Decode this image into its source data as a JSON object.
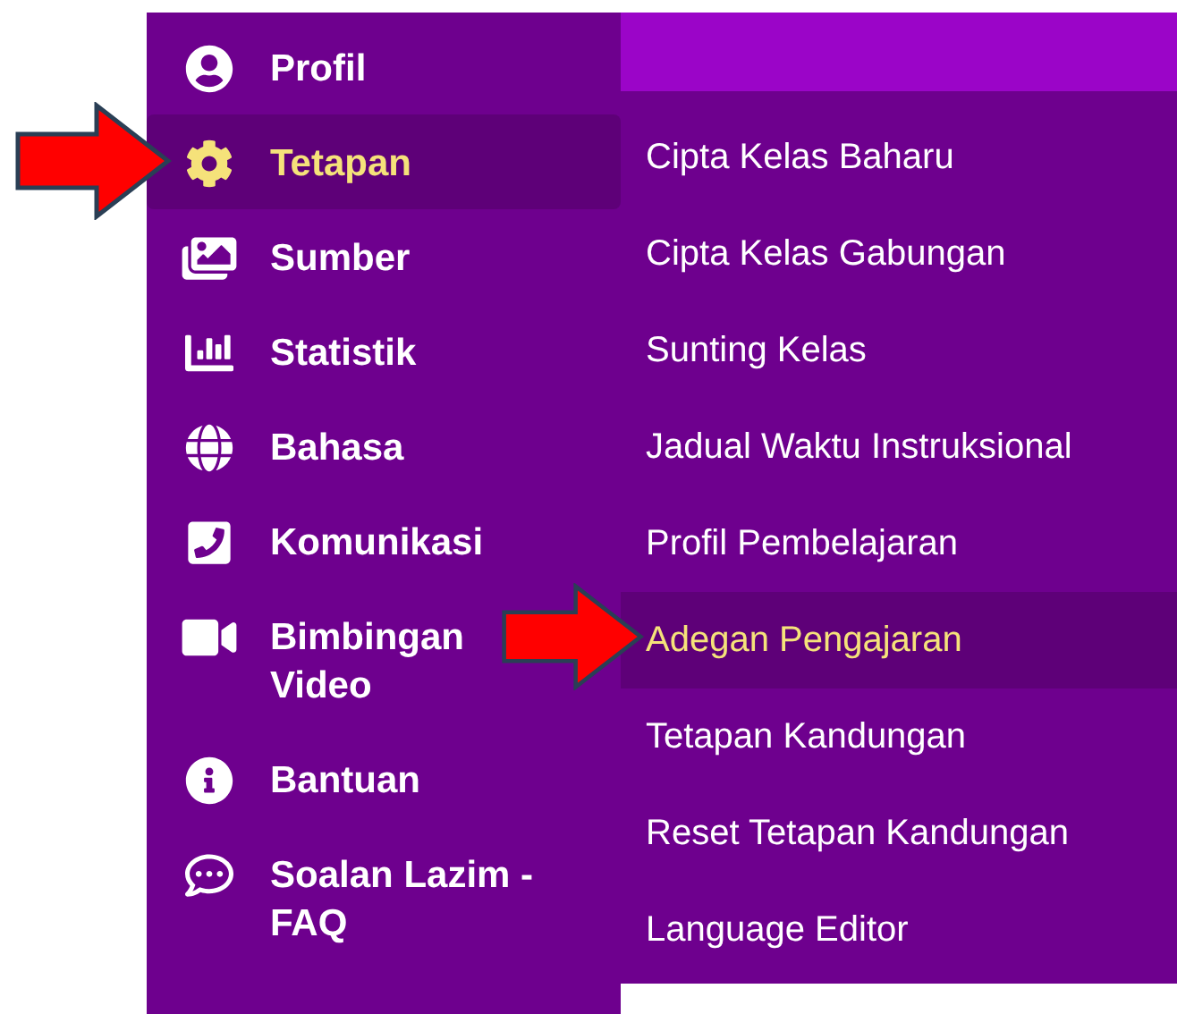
{
  "sidebar": {
    "items": [
      {
        "label": "Profil",
        "selected": false
      },
      {
        "label": "Tetapan",
        "selected": true
      },
      {
        "label": "Sumber",
        "selected": false
      },
      {
        "label": "Statistik",
        "selected": false
      },
      {
        "label": "Bahasa",
        "selected": false
      },
      {
        "label": "Komunikasi",
        "selected": false
      },
      {
        "label": "Bimbingan Video",
        "selected": false
      },
      {
        "label": "Bantuan",
        "selected": false
      },
      {
        "label": "Soalan Lazim - FAQ",
        "selected": false
      }
    ]
  },
  "submenu": {
    "items": [
      {
        "label": "Cipta Kelas Baharu",
        "selected": false
      },
      {
        "label": "Cipta Kelas Gabungan",
        "selected": false
      },
      {
        "label": "Sunting Kelas",
        "selected": false
      },
      {
        "label": "Jadual Waktu Instruksional",
        "selected": false
      },
      {
        "label": "Profil Pembelajaran",
        "selected": false
      },
      {
        "label": "Adegan Pengajaran",
        "selected": true
      },
      {
        "label": "Tetapan Kandungan",
        "selected": false
      },
      {
        "label": "Reset Tetapan Kandungan",
        "selected": false
      },
      {
        "label": "Language Editor",
        "selected": false
      }
    ]
  }
}
